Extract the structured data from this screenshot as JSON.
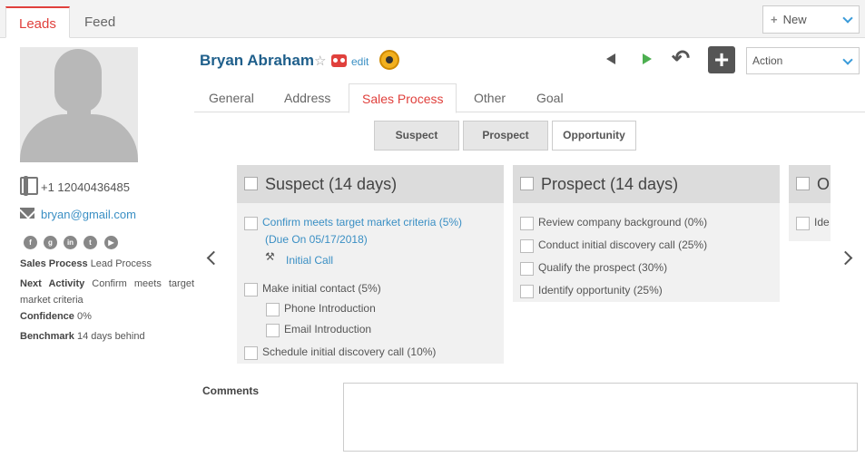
{
  "top_tabs": [
    "Leads",
    "Feed"
  ],
  "new_button": "New",
  "profile": {
    "phone": "+1 12040436485",
    "email": "bryan@gmail.com",
    "socials": [
      "facebook-icon",
      "google-plus-icon",
      "linkedin-icon",
      "twitter-icon",
      "youtube-icon"
    ],
    "sales_process_label": "Sales Process",
    "sales_process_value": "Lead Process",
    "next_activity_label": "Next Activity",
    "next_activity_value": "Confirm meets target market criteria",
    "confidence_label": "Confidence",
    "confidence_value": "0%",
    "benchmark_label": "Benchmark",
    "benchmark_value": "14 days behind"
  },
  "header": {
    "name": "Bryan Abraham",
    "edit": "edit",
    "action_select": "Action"
  },
  "sub_tabs": [
    "General",
    "Address",
    "Sales Process",
    "Other",
    "Goal"
  ],
  "stage_buttons": [
    "Suspect",
    "Prospect",
    "Opportunity"
  ],
  "columns": [
    {
      "title": "Suspect (14 days)",
      "tasks": [
        {
          "label": "Confirm meets target market criteria (5%)",
          "due": "(Due On 05/17/2018)",
          "activity": "Initial Call"
        },
        {
          "label": "Make initial contact (5%)",
          "subtasks": [
            "Phone Introduction",
            "Email Introduction"
          ]
        },
        {
          "label": "Schedule initial discovery call (10%)"
        }
      ]
    },
    {
      "title": "Prospect (14 days)",
      "tasks": [
        {
          "label": "Review company background (0%)"
        },
        {
          "label": "Conduct initial discovery call (25%)"
        },
        {
          "label": "Qualify the prospect (30%)"
        },
        {
          "label": "Identify opportunity (25%)"
        }
      ]
    },
    {
      "title": "O",
      "tasks": [
        {
          "label": "Ide"
        }
      ]
    }
  ],
  "comments_label": "Comments",
  "colors": {
    "accent": "#e0403c",
    "link": "#3a8fc4",
    "name": "#1f5f8b"
  }
}
